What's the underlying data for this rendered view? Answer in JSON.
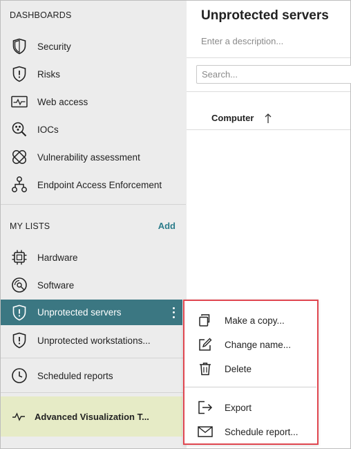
{
  "sidebar": {
    "dashboards_title": "DASHBOARDS",
    "dashboards": [
      {
        "label": "Security",
        "icon": "shield-icon"
      },
      {
        "label": "Risks",
        "icon": "shield-alert-icon"
      },
      {
        "label": "Web access",
        "icon": "web-activity-icon"
      },
      {
        "label": "IOCs",
        "icon": "ioc-magnifier-icon"
      },
      {
        "label": "Vulnerability assessment",
        "icon": "bandage-icon"
      },
      {
        "label": "Endpoint Access Enforcement",
        "icon": "network-nodes-icon"
      }
    ],
    "my_lists_title": "MY LISTS",
    "add_label": "Add",
    "lists": [
      {
        "label": "Hardware",
        "icon": "chip-icon"
      },
      {
        "label": "Software",
        "icon": "disc-icon"
      },
      {
        "label": "Unprotected servers",
        "icon": "shield-alert-icon",
        "active": true
      },
      {
        "label": "Unprotected workstations...",
        "icon": "shield-alert-icon"
      }
    ],
    "scheduled_reports": "Scheduled reports",
    "advanced_visualization": "Advanced Visualization T..."
  },
  "main": {
    "title": "Unprotected servers",
    "description_placeholder": "Enter a description...",
    "search_placeholder": "Search...",
    "column_header": "Computer"
  },
  "context_menu": {
    "items": [
      {
        "label": "Make a copy...",
        "icon": "copy-icon"
      },
      {
        "label": "Change name...",
        "icon": "edit-icon"
      },
      {
        "label": "Delete",
        "icon": "trash-icon"
      },
      {
        "label": "Export",
        "icon": "export-icon"
      },
      {
        "label": "Schedule report...",
        "icon": "envelope-icon"
      }
    ]
  },
  "colors": {
    "sidebar_bg": "#ececec",
    "active_item_bg": "#3b7782",
    "accent": "#2b7c8a",
    "highlight_border": "#e0464f",
    "advanced_bg": "#e6ebc6"
  }
}
